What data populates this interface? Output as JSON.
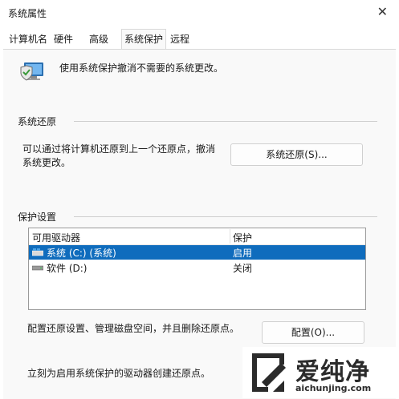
{
  "window": {
    "title": "系统属性",
    "close_glyph": "✕"
  },
  "tabs": [
    {
      "label": "计算机名"
    },
    {
      "label": "硬件"
    },
    {
      "label": "高级"
    },
    {
      "label": "系统保护",
      "active": true
    },
    {
      "label": "远程"
    }
  ],
  "intro": {
    "text": "使用系统保护撤消不需要的系统更改。",
    "icon": "computer-shield-icon"
  },
  "restore": {
    "title": "系统还原",
    "description_line1": "可以通过将计算机还原到上一个还原点，撤消",
    "description_line2": "系统更改。",
    "button": "系统还原(S)..."
  },
  "protection": {
    "title": "保护设置",
    "columns": [
      "可用驱动器",
      "保护"
    ],
    "rows": [
      {
        "drive": "系统 (C:) (系统)",
        "status": "启用",
        "selected": true,
        "icon": "system-drive-icon"
      },
      {
        "drive": "软件 (D:)",
        "status": "关闭",
        "selected": false,
        "icon": "drive-icon"
      }
    ],
    "config_text": "配置还原设置、管理磁盘空间，并且删除还原点。",
    "config_button": "配置(O)...",
    "create_text": "立刻为启用系统保护的驱动器创建还原点。"
  },
  "watermark": {
    "brand": "爱纯净",
    "url": "aichunjing.com"
  },
  "colors": {
    "selection": "#0f6cbd",
    "panel_bg": "#f9f9f9"
  }
}
